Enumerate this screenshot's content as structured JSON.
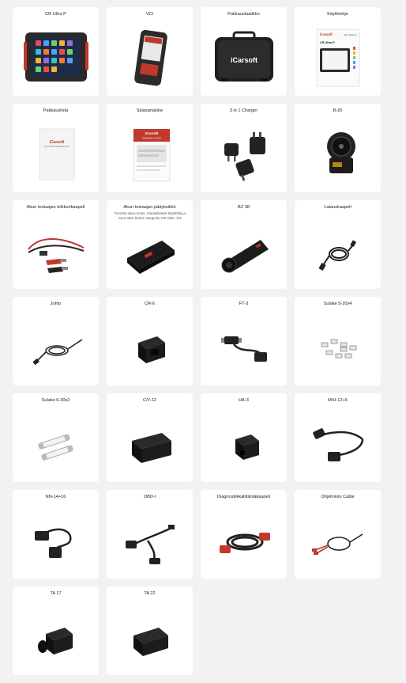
{
  "items": [
    {
      "title": "CR Ultra P",
      "icon": "tablet-icon"
    },
    {
      "title": "VCI",
      "icon": "vci-device-icon"
    },
    {
      "title": "Pakkauslaatikko",
      "icon": "carry-case-icon"
    },
    {
      "title": "Käyttöohje",
      "icon": "user-manual-icon",
      "manual_brand": "iCarsoft",
      "manual_model": "CR Ultra P",
      "manual_header": "User Manual"
    },
    {
      "title": "Pakkauslista",
      "icon": "packing-list-icon",
      "doc_brand": "iCarsoft",
      "doc_line": "CR ULTRA P PACKING LIST"
    },
    {
      "title": "Salasanakirje",
      "icon": "password-letter-icon",
      "doc_brand": "iCarsoft",
      "doc_line": "PASSWORD LETTER"
    },
    {
      "title": "3 in 1 Charger",
      "icon": "charger-icon"
    },
    {
      "title": "B-20",
      "icon": "b20-connector-icon"
    },
    {
      "title": "Akun testaajan leikkurikaapeli",
      "icon": "clamp-cable-icon"
    },
    {
      "title": "Akun testaajan pääyksikkö",
      "icon": "battery-tester-icon",
      "description": "Tunnista akun kunto, reaaliaikaiset käyttötila ja muut akun tiedot. Integroitu CR Ultra –ksi"
    },
    {
      "title": "BZ 38",
      "icon": "bz38-adapter-icon"
    },
    {
      "title": "Latauskaapeli",
      "icon": "charging-cable-icon"
    },
    {
      "title": "Johto",
      "icon": "cord-icon"
    },
    {
      "title": "CR-6",
      "icon": "cr6-adapter-icon"
    },
    {
      "title": "FT-3",
      "icon": "ft3-cable-icon"
    },
    {
      "title": "Sulake 5-20x4",
      "icon": "fuses-icon"
    },
    {
      "title": "Sulake 6-30x2",
      "icon": "glass-fuse-icon"
    },
    {
      "title": "C/V-12",
      "icon": "cv12-adapter-icon"
    },
    {
      "title": "HA-3",
      "icon": "ha3-adapter-icon"
    },
    {
      "title": "M/H-12+6",
      "icon": "mh-cable-icon"
    },
    {
      "title": "NN-14+16",
      "icon": "nn-cable-icon"
    },
    {
      "title": "OBD-I",
      "icon": "obd1-cable-icon"
    },
    {
      "title": "Diagnostiikkaliitäntäkaapeli",
      "icon": "diagnostic-cable-icon"
    },
    {
      "title": "Ohjelmisto Cable",
      "icon": "software-cable-icon"
    },
    {
      "title": "TA 17",
      "icon": "ta17-adapter-icon"
    },
    {
      "title": "TA 22",
      "icon": "ta22-adapter-icon"
    }
  ]
}
